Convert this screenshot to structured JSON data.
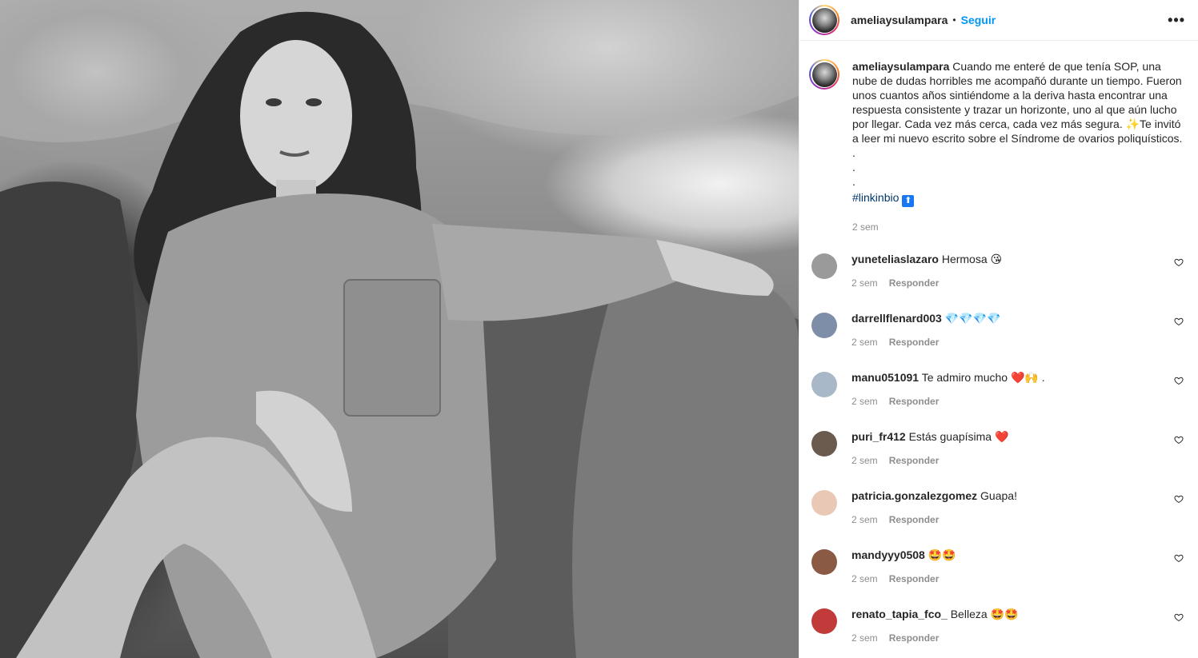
{
  "post": {
    "username": "ameliaysulampara",
    "follow_label": "Seguir",
    "separator": "•",
    "more_label": "•••"
  },
  "caption": {
    "username": "ameliaysulampara",
    "text_part1": " Cuando me enteré de que tenía SOP, una nube de dudas horribles me acompañó durante un tiempo. Fueron unos cuantos años sintiéndome a la deriva hasta encontrar una respuesta consistente y trazar un horizonte, uno al que aún lucho por llegar. Cada vez más cerca, cada vez más segura. ",
    "sparkle_emoji": "✨",
    "text_part2": "Te invitó a leer mi nuevo escrito sobre el Síndrome de ovarios poliquísticos.",
    "dot1": ".",
    "dot2": ".",
    "dot3": ".",
    "hashtag": "#linkinbio",
    "arrow_emoji": "⬆",
    "time": "2 sem"
  },
  "comments": [
    {
      "user": "yuneteliaslazaro",
      "text": " Hermosa ",
      "emoji": "😘",
      "time": "2 sem",
      "reply": "Responder",
      "avatar_color": "#9a9a9a"
    },
    {
      "user": "darrellflenard003",
      "text": " ",
      "emoji": "💎💎💎💎",
      "time": "2 sem",
      "reply": "Responder",
      "avatar_color": "#7f8ea8"
    },
    {
      "user": "manu051091",
      "text": " Te admiro mucho ",
      "emoji": "❤️🙌 .",
      "time": "2 sem",
      "reply": "Responder",
      "avatar_color": "#a9b8c8"
    },
    {
      "user": "puri_fr412",
      "text": " Estás guapísima ",
      "emoji": "❤️",
      "time": "2 sem",
      "reply": "Responder",
      "avatar_color": "#6b5a4e"
    },
    {
      "user": "patricia.gonzalezgomez",
      "text": " Guapa!",
      "emoji": "",
      "time": "2 sem",
      "reply": "Responder",
      "avatar_color": "#e9c9b5"
    },
    {
      "user": "mandyyy0508",
      "text": " ",
      "emoji": "🤩🤩",
      "time": "2 sem",
      "reply": "Responder",
      "avatar_color": "#8a5a44"
    },
    {
      "user": "renato_tapia_fco_",
      "text": " Belleza ",
      "emoji": "🤩🤩",
      "time": "2 sem",
      "reply": "Responder",
      "avatar_color": "#c23b3b"
    }
  ]
}
